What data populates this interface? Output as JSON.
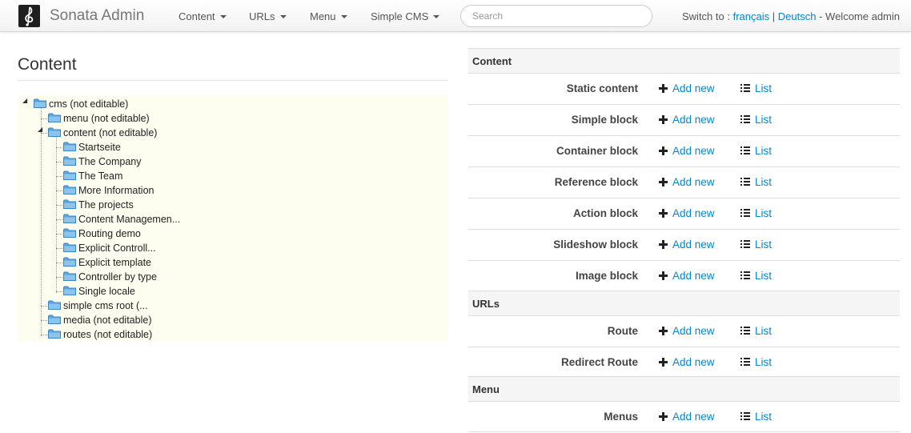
{
  "brand": {
    "title": "Sonata Admin",
    "logo_icon": "treble-clef-icon"
  },
  "nav": {
    "items": [
      {
        "label": "Content"
      },
      {
        "label": "URLs"
      },
      {
        "label": "Menu"
      },
      {
        "label": "Simple CMS"
      }
    ],
    "search_placeholder": "Search",
    "switch_label": "Switch to :",
    "lang_fr": "français",
    "separator": "|",
    "lang_de": "Deutsch",
    "welcome": "- Welcome admin"
  },
  "content_panel": {
    "title": "Content",
    "tree": [
      {
        "label": "cms (not editable)",
        "level": 0,
        "expanded": true
      },
      {
        "label": "menu (not editable)",
        "level": 1,
        "expanded": false
      },
      {
        "label": "content (not editable)",
        "level": 1,
        "expanded": true
      },
      {
        "label": "Startseite",
        "level": 2
      },
      {
        "label": "The Company",
        "level": 2
      },
      {
        "label": "The Team",
        "level": 2
      },
      {
        "label": "More Information",
        "level": 2
      },
      {
        "label": "The projects",
        "level": 2
      },
      {
        "label": "Content Managemen...",
        "level": 2
      },
      {
        "label": "Routing demo",
        "level": 2
      },
      {
        "label": "Explicit Controll...",
        "level": 2
      },
      {
        "label": "Explicit template",
        "level": 2
      },
      {
        "label": "Controller by type",
        "level": 2
      },
      {
        "label": "Single locale",
        "level": 2
      },
      {
        "label": "simple cms root (...",
        "level": 1
      },
      {
        "label": "media (not editable)",
        "level": 1
      },
      {
        "label": "routes (not editable)",
        "level": 1
      }
    ]
  },
  "dashboard": {
    "add_label": "Add new",
    "list_label": "List",
    "groups": [
      {
        "title": "Content",
        "items": [
          "Static content",
          "Simple block",
          "Container block",
          "Reference block",
          "Action block",
          "Slideshow block",
          "Image block"
        ]
      },
      {
        "title": "URLs",
        "items": [
          "Route",
          "Redirect Route"
        ]
      },
      {
        "title": "Menu",
        "items": [
          "Menus"
        ]
      }
    ]
  },
  "colors": {
    "link": "#0088cc",
    "tree_bg": "#fefef0",
    "header_bg": "#f5f5f5",
    "folder": "#5aa6e0"
  }
}
